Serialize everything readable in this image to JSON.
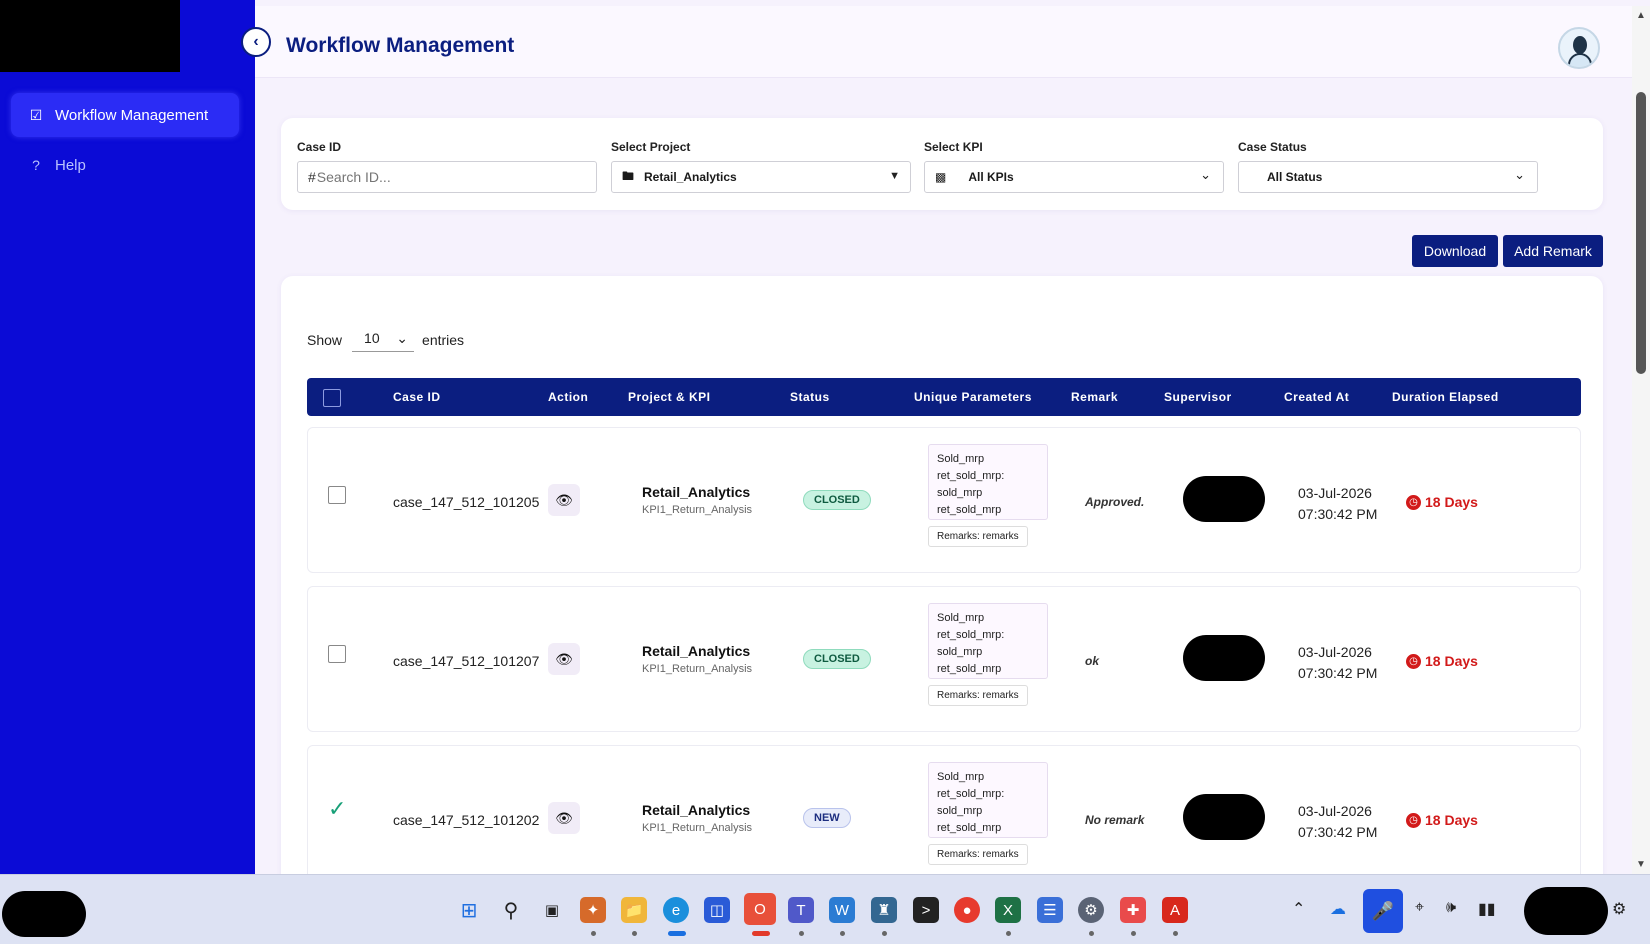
{
  "app": {
    "page_title": "Workflow Management"
  },
  "sidebar": {
    "items": [
      {
        "label": "Workflow Management",
        "icon": "edit-check-icon",
        "active": true
      },
      {
        "label": "Help",
        "icon": "question-icon",
        "active": false
      }
    ]
  },
  "filters": {
    "case_id": {
      "label": "Case ID",
      "placeholder": "Search ID...",
      "prefix": "#"
    },
    "project": {
      "label": "Select Project",
      "value": "Retail_Analytics",
      "icon": "folder-icon"
    },
    "kpi": {
      "label": "Select KPI",
      "value": "All KPIs",
      "icon": "hierarchy-icon"
    },
    "status": {
      "label": "Case Status",
      "value": "All Status"
    }
  },
  "actions": {
    "download_label": "Download",
    "add_remark_label": "Add Remark"
  },
  "table": {
    "show_label": "Show",
    "entries_value": "10",
    "entries_label": "entries",
    "columns": [
      "Case ID",
      "Action",
      "Project & KPI",
      "Status",
      "Unique Parameters",
      "Remark",
      "Supervisor",
      "Created At",
      "Duration Elapsed"
    ],
    "rows": [
      {
        "checked": false,
        "case_id": "case_147_512_101205",
        "project": "Retail_Analytics",
        "kpi": "KPI1_Return_Analysis",
        "status": "CLOSED",
        "params": [
          "Sold_mrp",
          "ret_sold_mrp:",
          "sold_mrp",
          "ret_sold_mrp"
        ],
        "remarks_tag": "Remarks: remarks",
        "remark": "Approved.",
        "created_date": "03-Jul-2026",
        "created_time": "07:30:42 PM",
        "duration": "18 Days"
      },
      {
        "checked": false,
        "case_id": "case_147_512_101207",
        "project": "Retail_Analytics",
        "kpi": "KPI1_Return_Analysis",
        "status": "CLOSED",
        "params": [
          "Sold_mrp",
          "ret_sold_mrp:",
          "sold_mrp",
          "ret_sold_mrp"
        ],
        "remarks_tag": "Remarks: remarks",
        "remark": "ok",
        "created_date": "03-Jul-2026",
        "created_time": "07:30:42 PM",
        "duration": "18 Days"
      },
      {
        "checked": true,
        "case_id": "case_147_512_101202",
        "project": "Retail_Analytics",
        "kpi": "KPI1_Return_Analysis",
        "status": "NEW",
        "params": [
          "Sold_mrp",
          "ret_sold_mrp:",
          "sold_mrp",
          "ret_sold_mrp"
        ],
        "remarks_tag": "Remarks: remarks",
        "remark": "No remark",
        "created_date": "03-Jul-2026",
        "created_time": "07:30:42 PM",
        "duration": "18 Days"
      }
    ]
  },
  "colors": {
    "sidebar": "#0b0bd6",
    "header_blue": "#0b1e80",
    "closed_bg": "#c8f2e1",
    "duration_red": "#d21a1a"
  }
}
